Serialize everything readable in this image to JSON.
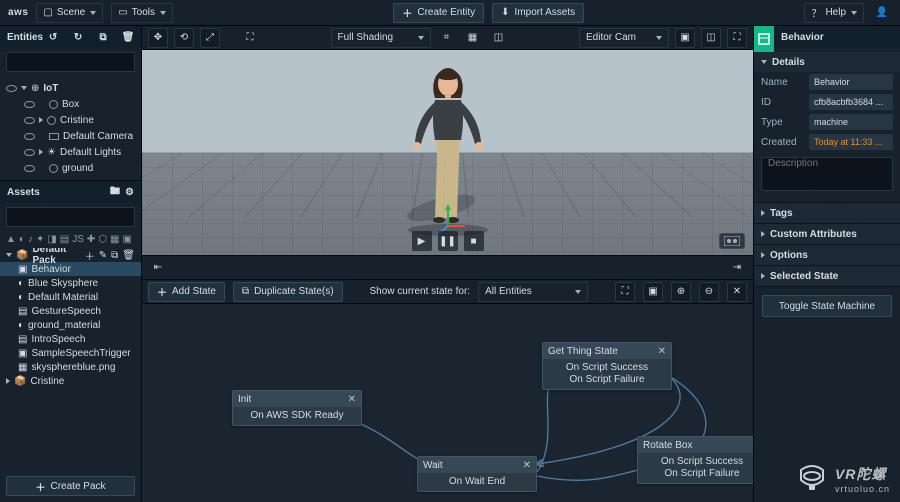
{
  "topbar": {
    "logo": "aws",
    "scene_menu": "Scene",
    "tools_menu": "Tools",
    "create_entity": "Create Entity",
    "import_assets": "Import Assets",
    "help_menu": "Help"
  },
  "entities": {
    "title": "Entities",
    "search_placeholder": "",
    "root": "IoT",
    "items": [
      {
        "label": "Box",
        "icon": "circle"
      },
      {
        "label": "Cristine",
        "icon": "circle",
        "expandable": true
      },
      {
        "label": "Default Camera",
        "icon": "camera"
      },
      {
        "label": "Default Lights",
        "icon": "sun",
        "expandable": true
      },
      {
        "label": "ground",
        "icon": "circle"
      }
    ]
  },
  "assets": {
    "title": "Assets",
    "search_placeholder": "",
    "pack_label": "Default Pack",
    "items": [
      {
        "label": "Behavior",
        "selected": true
      },
      {
        "label": "Blue Skysphere"
      },
      {
        "label": "Default Material"
      },
      {
        "label": "GestureSpeech"
      },
      {
        "label": "ground_material"
      },
      {
        "label": "IntroSpeech"
      },
      {
        "label": "SampleSpeechTrigger"
      },
      {
        "label": "skysphereblue.png"
      }
    ],
    "cristine_label": "Cristine",
    "create_pack": "Create Pack"
  },
  "viewport": {
    "shading": "Full Shading",
    "camera": "Editor Cam"
  },
  "state_panel": {
    "add_state": "Add State",
    "duplicate_states": "Duplicate State(s)",
    "show_current_label": "Show current state for:",
    "entity_filter": "All Entities",
    "nodes": {
      "init": {
        "title": "Init",
        "event": "On AWS SDK Ready"
      },
      "wait": {
        "title": "Wait",
        "event": "On Wait End"
      },
      "get_thing": {
        "title": "Get Thing State",
        "e1": "On Script Success",
        "e2": "On Script Failure"
      },
      "rotate": {
        "title": "Rotate Box",
        "e1": "On Script Success",
        "e2": "On Script Failure"
      }
    }
  },
  "inspector": {
    "tab_label": "Behavior",
    "details": "Details",
    "name_k": "Name",
    "name_v": "Behavior",
    "id_k": "ID",
    "id_v": "cfb8acbfb3684 ...",
    "type_k": "Type",
    "type_v": "machine",
    "created_k": "Created",
    "created_v": "Today at 11:33 ...",
    "desc_placeholder": "Description",
    "tags": "Tags",
    "custom_attrs": "Custom Attributes",
    "options": "Options",
    "selected_state": "Selected State",
    "toggle_btn": "Toggle State Machine"
  },
  "watermark": {
    "brand": "VR陀螺",
    "url": "vrtuoluo.cn"
  }
}
